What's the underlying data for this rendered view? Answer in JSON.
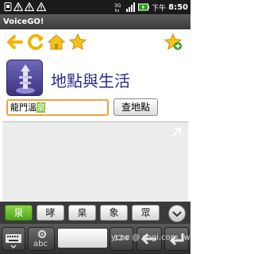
{
  "status_bar": {
    "icons": [
      "sim-icon",
      "warning-icon",
      "warning-icon",
      "warning-icon",
      "3g-icon",
      "signal-icon",
      "battery-icon"
    ],
    "time_prefix": "下午",
    "time": "8:50"
  },
  "app": {
    "title": "VoiceGO!"
  },
  "toolbar": {
    "items": [
      "back-arrow-icon",
      "refresh-icon",
      "home-icon",
      "star-icon",
      "add-favorite-icon"
    ]
  },
  "category": {
    "title": "地點與生活"
  },
  "search": {
    "value_committed": "龍門溫",
    "value_composing": "泉",
    "button_label": "查地點"
  },
  "candidates": {
    "items": [
      "泉",
      "㫴",
      "臬",
      "象",
      "眾"
    ],
    "selected_index": 0
  },
  "keyboard": {
    "abc_label": "abc",
    "num_label": "12#"
  },
  "watermark": "ycoc @ sogi.com.tw",
  "colors": {
    "accent_orange": "#f0a23a",
    "category_purple": "#2c2a8c",
    "candidate_green": "#5bb224"
  }
}
